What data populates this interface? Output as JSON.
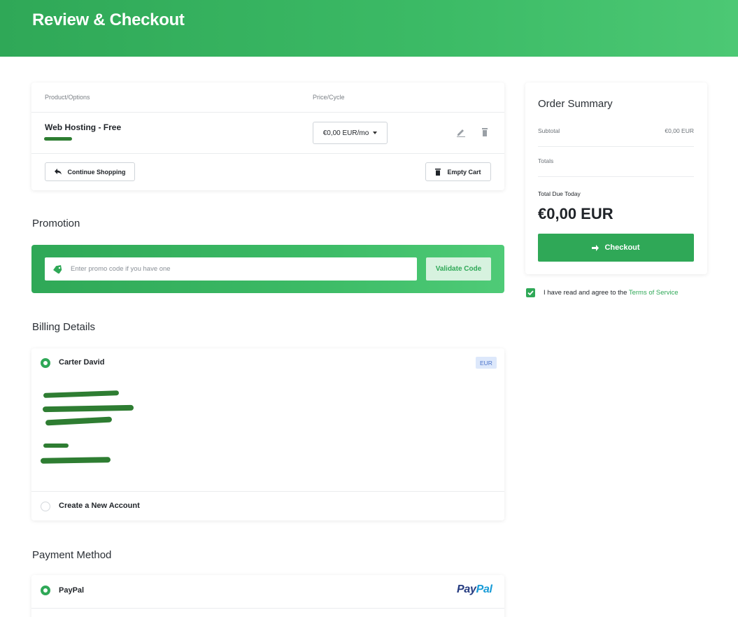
{
  "header": {
    "title": "Review & Checkout"
  },
  "cart": {
    "col_product": "Product/Options",
    "col_price": "Price/Cycle",
    "items": [
      {
        "name": "Web Hosting - Free",
        "price_cycle": "€0,00 EUR/mo"
      }
    ],
    "continue_label": "Continue Shopping",
    "empty_label": "Empty Cart"
  },
  "promotion": {
    "title": "Promotion",
    "placeholder": "Enter promo code if you have one",
    "validate_label": "Validate Code"
  },
  "billing": {
    "title": "Billing Details",
    "account_name": "Carter David",
    "currency_badge": "EUR",
    "new_account_label": "Create a New Account"
  },
  "payment": {
    "title": "Payment Method",
    "method_label": "PayPal",
    "logo_pay": "Pay",
    "logo_pal": "Pal"
  },
  "summary": {
    "title": "Order Summary",
    "subtotal_label": "Subtotal",
    "subtotal_value": "€0,00 EUR",
    "totals_label": "Totals",
    "due_label": "Total Due Today",
    "due_amount": "€0,00 EUR",
    "checkout_label": "Checkout"
  },
  "tos": {
    "text": "I have read and agree to the",
    "link": "Terms of Service",
    "checked": true
  },
  "colors": {
    "accent": "#2fa857",
    "redaction": "#2e7d32"
  },
  "icons": {
    "edit": "pencil-icon",
    "delete": "trash-icon",
    "continue": "arrow-back-icon",
    "empty": "trash-icon",
    "promo": "tag-icon",
    "checkout": "arrow-right-icon",
    "tos": "check-icon"
  }
}
